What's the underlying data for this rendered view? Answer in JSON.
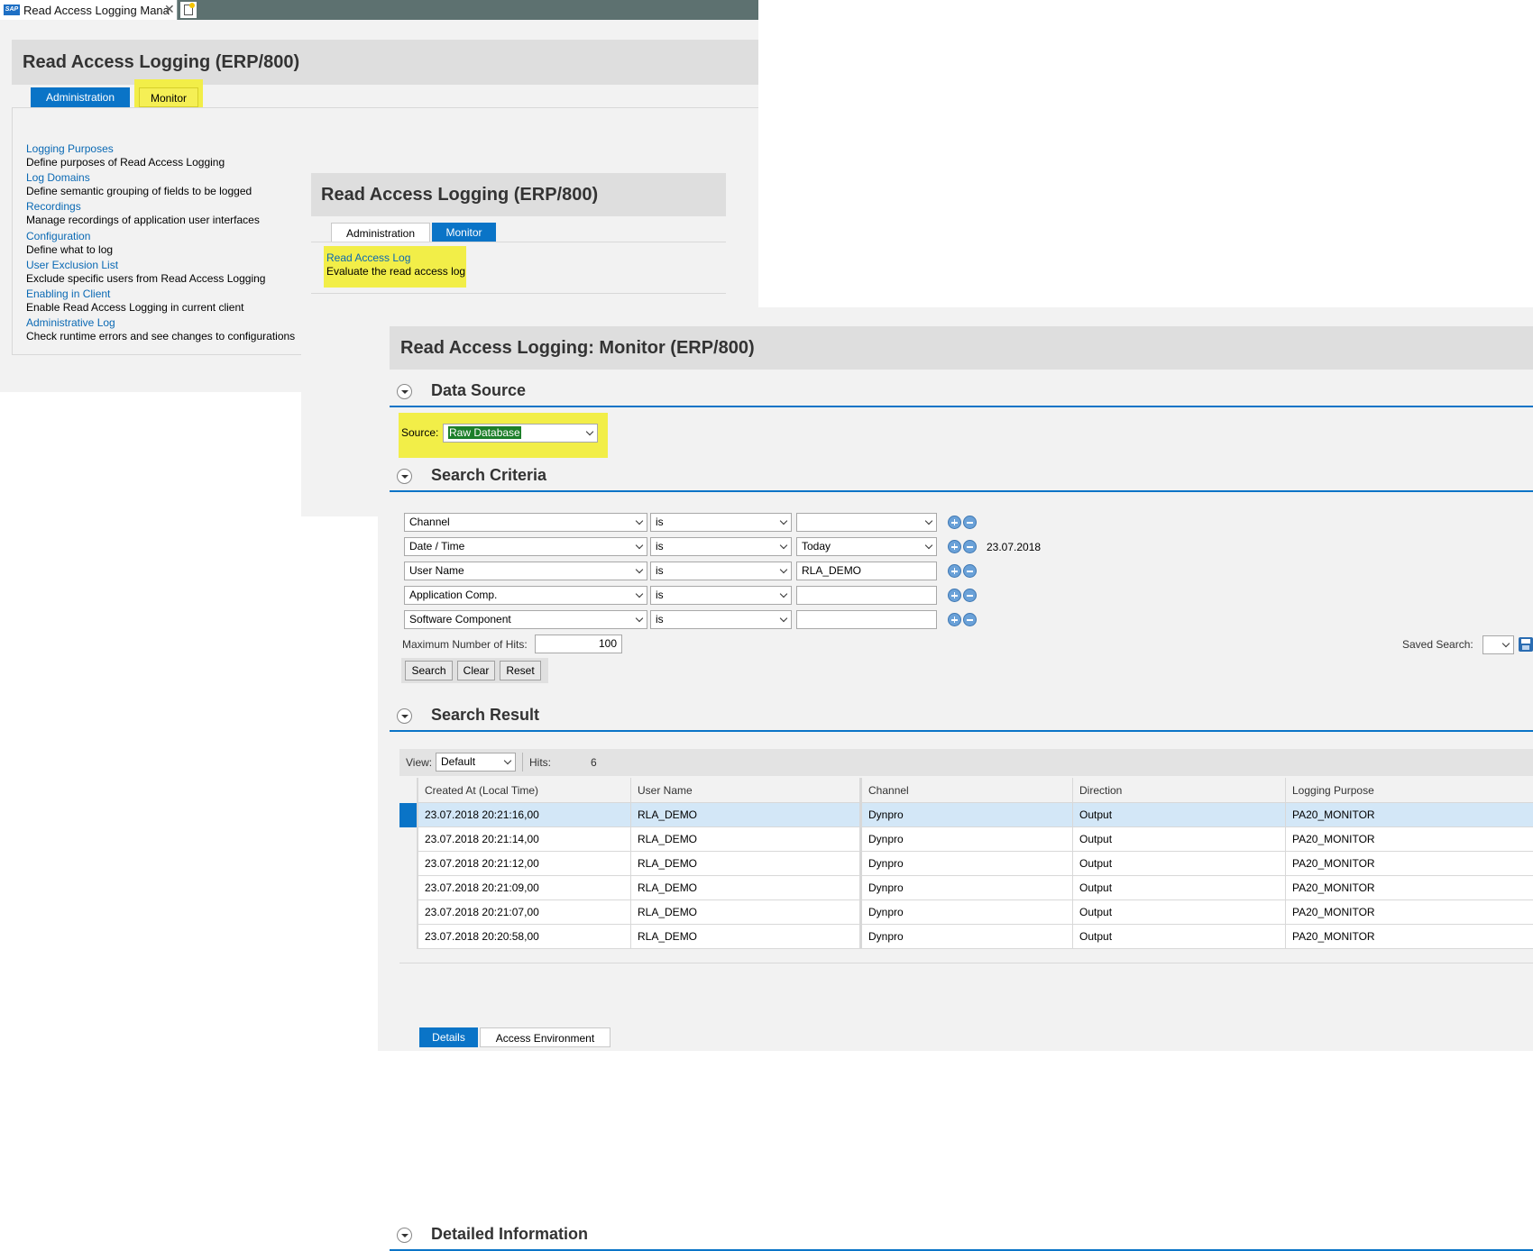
{
  "window": {
    "tab_title": "Read Access Logging Mana",
    "sap_logo": "SAP"
  },
  "panel1": {
    "title": "Read Access Logging (ERP/800)",
    "tabs": {
      "administration": "Administration",
      "monitor": "Monitor"
    },
    "items": [
      {
        "link": "Logging Purposes",
        "desc": "Define purposes of Read Access Logging"
      },
      {
        "link": "Log Domains",
        "desc": "Define semantic grouping of fields to be logged"
      },
      {
        "link": "Recordings",
        "desc": "Manage recordings of application user interfaces"
      },
      {
        "link": "Configuration",
        "desc": "Define what to log"
      },
      {
        "link": "User Exclusion List",
        "desc": "Exclude specific users from Read Access Logging"
      },
      {
        "link": "Enabling in Client",
        "desc": "Enable Read Access Logging in current client"
      },
      {
        "link": "Administrative Log",
        "desc": "Check runtime errors and see changes to configurations"
      }
    ]
  },
  "panel2": {
    "title": "Read Access Logging (ERP/800)",
    "tabs": {
      "administration": "Administration",
      "monitor": "Monitor"
    },
    "item": {
      "link": "Read Access Log",
      "desc": "Evaluate the read access log"
    }
  },
  "monitor": {
    "title": "Read Access Logging: Monitor (ERP/800)",
    "data_source": {
      "section": "Data Source",
      "label": "Source:",
      "value": "Raw Database"
    },
    "search_criteria": {
      "section": "Search Criteria",
      "rows": [
        {
          "field": "Channel",
          "op": "is",
          "value": "",
          "extra": ""
        },
        {
          "field": "Date / Time",
          "op": "is",
          "value": "Today",
          "extra": "23.07.2018"
        },
        {
          "field": "User Name",
          "op": "is",
          "value": "RLA_DEMO",
          "extra": ""
        },
        {
          "field": "Application Comp.",
          "op": "is",
          "value": "",
          "extra": ""
        },
        {
          "field": "Software Component",
          "op": "is",
          "value": "",
          "extra": ""
        }
      ],
      "max_hits_label": "Maximum Number of Hits:",
      "max_hits": "100",
      "saved_search_label": "Saved Search:",
      "buttons": {
        "search": "Search",
        "clear": "Clear",
        "reset": "Reset"
      }
    },
    "search_result": {
      "section": "Search Result",
      "view_label": "View:",
      "view_value": "Default",
      "hits_label": "Hits:",
      "hits": "6",
      "columns": [
        "Created At (Local Time)",
        "User Name",
        "Channel",
        "Direction",
        "Logging Purpose"
      ],
      "rows": [
        [
          "23.07.2018 20:21:16,00",
          "RLA_DEMO",
          "Dynpro",
          "Output",
          "PA20_MONITOR"
        ],
        [
          "23.07.2018 20:21:14,00",
          "RLA_DEMO",
          "Dynpro",
          "Output",
          "PA20_MONITOR"
        ],
        [
          "23.07.2018 20:21:12,00",
          "RLA_DEMO",
          "Dynpro",
          "Output",
          "PA20_MONITOR"
        ],
        [
          "23.07.2018 20:21:09,00",
          "RLA_DEMO",
          "Dynpro",
          "Output",
          "PA20_MONITOR"
        ],
        [
          "23.07.2018 20:21:07,00",
          "RLA_DEMO",
          "Dynpro",
          "Output",
          "PA20_MONITOR"
        ],
        [
          "23.07.2018 20:20:58,00",
          "RLA_DEMO",
          "Dynpro",
          "Output",
          "PA20_MONITOR"
        ]
      ]
    },
    "detail": {
      "section": "Detailed Information",
      "tabs": {
        "details": "Details",
        "env": "Access Environment"
      }
    }
  }
}
